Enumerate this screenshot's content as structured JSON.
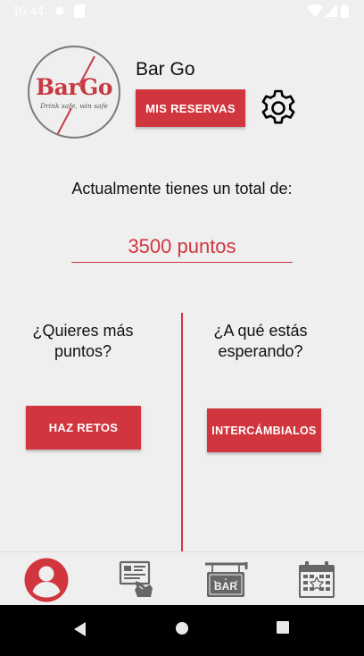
{
  "status_bar": {
    "time": "10:44",
    "left_icons": [
      "gear-icon",
      "sim-icon"
    ],
    "right_icons": [
      "wifi-icon",
      "signal-icon",
      "battery-icon"
    ]
  },
  "header": {
    "logo": {
      "brand": "BarGo",
      "tagline": "Drink safe, win safe"
    },
    "app_title": "Bar Go",
    "reservations_button": "MIS RESERVAS",
    "settings_icon": "gear-icon"
  },
  "points": {
    "label": "Actualmente tienes un total de:",
    "value": "3500 puntos"
  },
  "left_panel": {
    "question": "¿Quieres más puntos?",
    "button": "HAZ RETOS"
  },
  "right_panel": {
    "question": "¿A qué estás esperando?",
    "button": "INTERCÁMBIALOS"
  },
  "bottom_nav": {
    "items": [
      {
        "icon": "profile-icon",
        "active": true
      },
      {
        "icon": "challenges-icon",
        "active": false
      },
      {
        "icon": "bar-sign-icon",
        "active": false
      },
      {
        "icon": "calendar-icon",
        "active": false
      }
    ]
  },
  "system_nav": [
    "back-icon",
    "home-icon",
    "recents-icon"
  ],
  "colors": {
    "accent": "#d1363f",
    "background": "#efefef",
    "icon_gray": "#666666",
    "system_bar": "#000000"
  }
}
